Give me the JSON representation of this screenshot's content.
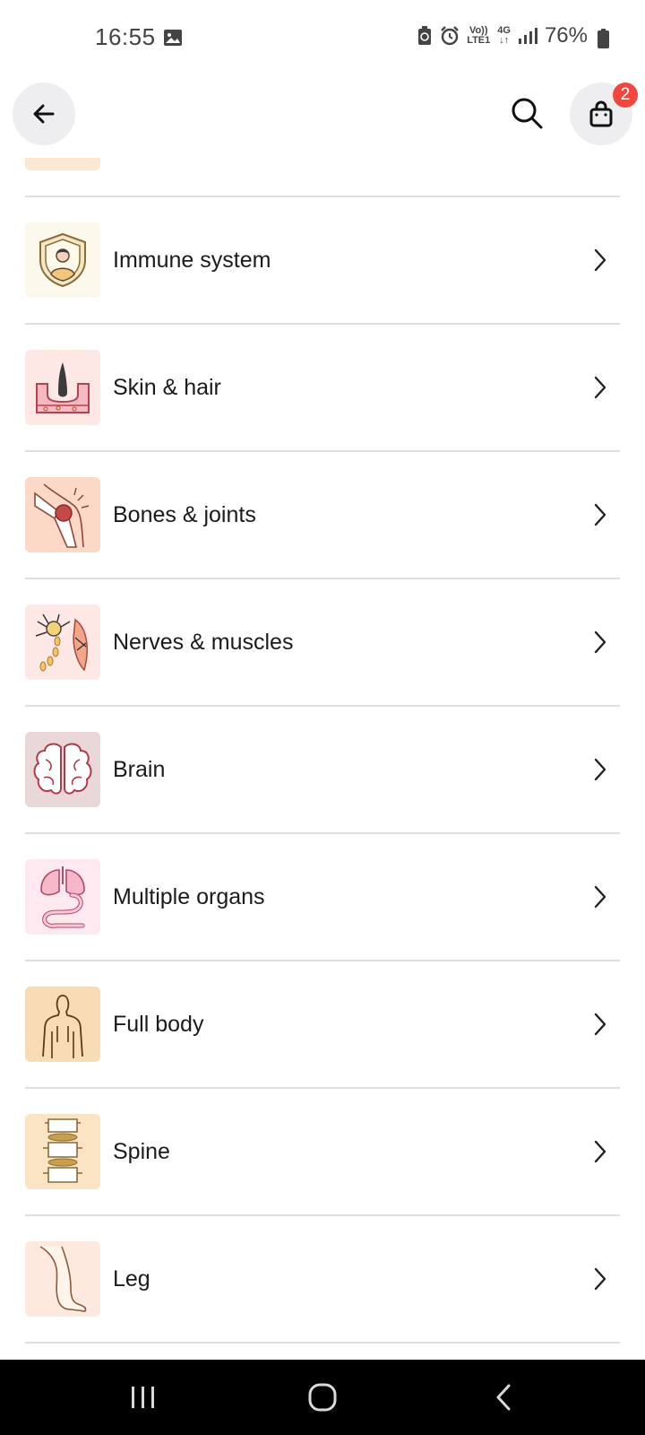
{
  "status_bar": {
    "time": "16:55",
    "net_top": "Vo))",
    "net_bottom": "LTE1",
    "gen": "4G",
    "battery": "76%"
  },
  "header": {
    "back_icon": "arrow-left-icon",
    "search_icon": "search-icon",
    "cart_icon": "shopping-bag-icon",
    "cart_count": "2"
  },
  "categories": [
    {
      "label": "Immune system",
      "icon": "shield-person-icon",
      "bg": "#fdf8ec"
    },
    {
      "label": "Skin & hair",
      "icon": "skin-hair-icon",
      "bg": "#fde8e6"
    },
    {
      "label": "Bones & joints",
      "icon": "knee-joint-icon",
      "bg": "#fcd9c6"
    },
    {
      "label": "Nerves & muscles",
      "icon": "neuron-muscle-icon",
      "bg": "#fde8e6"
    },
    {
      "label": "Brain",
      "icon": "brain-icon",
      "bg": "#ead8d8"
    },
    {
      "label": "Multiple organs",
      "icon": "organs-icon",
      "bg": "#fde9ef"
    },
    {
      "label": "Full body",
      "icon": "body-outline-icon",
      "bg": "#f7dcb5"
    },
    {
      "label": "Spine",
      "icon": "spine-icon",
      "bg": "#fbe4c4"
    },
    {
      "label": "Leg",
      "icon": "leg-icon",
      "bg": "#fde9dd"
    }
  ],
  "colors": {
    "badge": "#f0483e",
    "divider": "#dedede",
    "button_bg": "#eeeef0"
  }
}
